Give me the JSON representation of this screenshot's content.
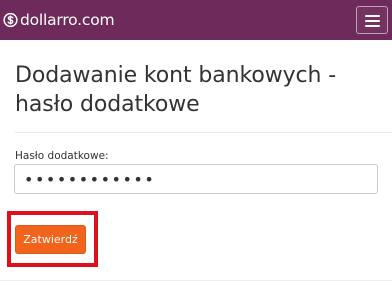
{
  "navbar": {
    "logo_icon": "dollar-circle-icon",
    "brand_text": "dollarro.com",
    "menu_icon": "hamburger-menu-icon",
    "background": "#6e2a5a"
  },
  "main": {
    "title": "Dodawanie kont bankowych - hasło dodatkowe",
    "password_label": "Hasło dodatkowe:",
    "password_value": "••••••••••••",
    "submit_label": "Zatwierdź",
    "button_color": "#f2631b",
    "highlight_color": "#e00f1c"
  }
}
